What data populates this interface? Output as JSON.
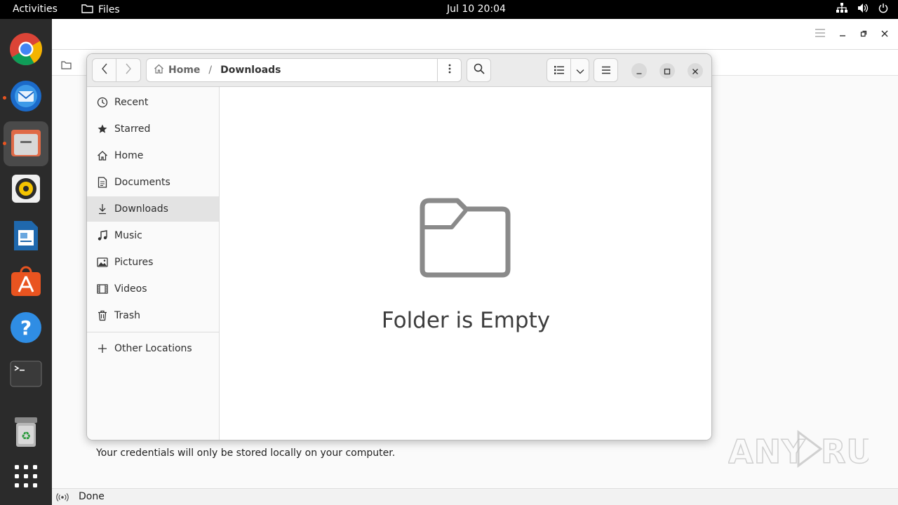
{
  "topbar": {
    "activities": "Activities",
    "app_name": "Files",
    "clock": "Jul 10  20:04"
  },
  "dock": {
    "items": [
      {
        "name": "chrome",
        "icon": "chrome-icon"
      },
      {
        "name": "thunderbird",
        "icon": "thunderbird-icon"
      },
      {
        "name": "files",
        "icon": "files-icon"
      },
      {
        "name": "rhythmbox",
        "icon": "rhythmbox-icon"
      },
      {
        "name": "libreoffice-writer",
        "icon": "writer-icon"
      },
      {
        "name": "software",
        "icon": "software-icon"
      },
      {
        "name": "help",
        "icon": "help-icon"
      },
      {
        "name": "terminal",
        "icon": "terminal-icon"
      },
      {
        "name": "trash",
        "icon": "trash-icon"
      },
      {
        "name": "show-apps",
        "icon": "apps-grid-icon"
      }
    ]
  },
  "background_app": {
    "credentials_note": "Your credentials will only be stored locally on your computer.",
    "status": "Done"
  },
  "watermark": "ANY RUN",
  "files_window": {
    "path": {
      "home": "Home",
      "separator": "/",
      "current": "Downloads"
    },
    "sidebar": {
      "items": [
        {
          "label": "Recent",
          "icon": "clock-icon"
        },
        {
          "label": "Starred",
          "icon": "star-icon"
        },
        {
          "label": "Home",
          "icon": "home-icon"
        },
        {
          "label": "Documents",
          "icon": "document-icon"
        },
        {
          "label": "Downloads",
          "icon": "download-icon",
          "selected": true
        },
        {
          "label": "Music",
          "icon": "music-icon"
        },
        {
          "label": "Pictures",
          "icon": "picture-icon"
        },
        {
          "label": "Videos",
          "icon": "video-icon"
        },
        {
          "label": "Trash",
          "icon": "trash-icon"
        }
      ],
      "other_locations": "Other Locations"
    },
    "empty_message": "Folder is Empty"
  },
  "colors": {
    "accent": "#e95420",
    "dock_bg": "#2b2b2b",
    "topbar_bg": "#000000"
  }
}
